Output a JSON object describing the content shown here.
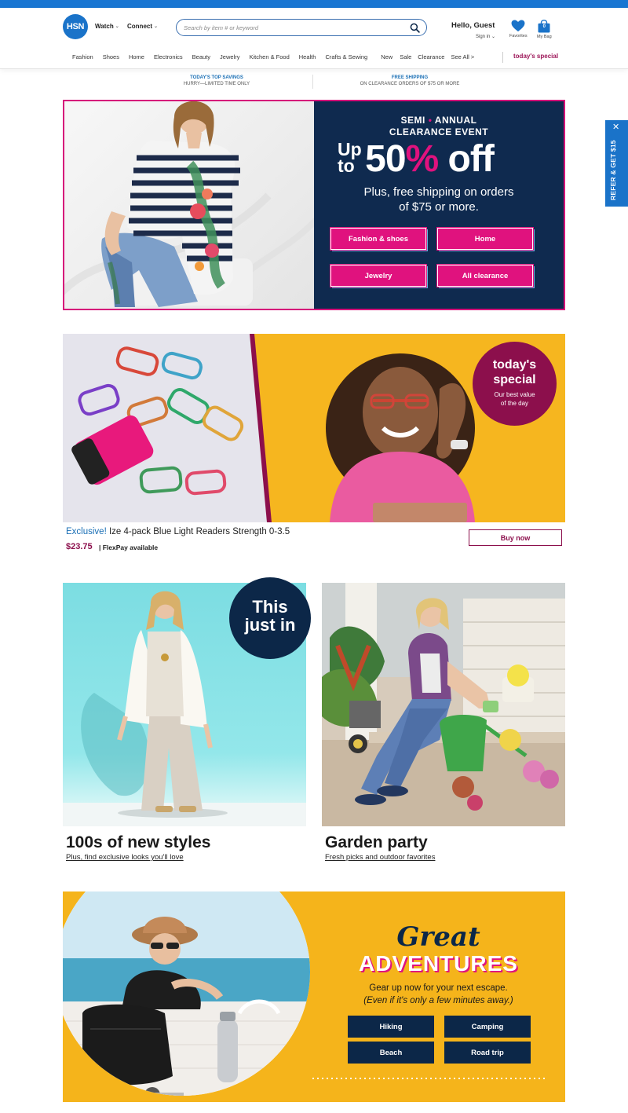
{
  "header": {
    "logo_text": "HSN",
    "watch_label": "Watch",
    "connect_label": "Connect",
    "search_placeholder": "Search by item # or keyword",
    "greeting": "Hello, Guest",
    "signin_label": "Sign in",
    "favorites_label": "Favorites",
    "bag_label": "My Bag",
    "bag_count": "0",
    "brand_color": "#1a73c9"
  },
  "categories": [
    "Fashion",
    "Shoes",
    "Home",
    "Electronics",
    "Beauty",
    "Jewelry",
    "Kitchen & Food",
    "Health",
    "Crafts & Sewing",
    "New",
    "Sale",
    "Clearance",
    "See All >"
  ],
  "todays_special_link": "today's special",
  "promo": {
    "savings_title": "TODAY'S TOP SAVINGS",
    "savings_sub": "HURRY—LIMITED TIME ONLY",
    "shipping_title": "FREE SHIPPING",
    "shipping_sub": "ON CLEARANCE ORDERS OF $75 OR MORE"
  },
  "hero": {
    "title_line1": "SEMI",
    "title_line1b": "ANNUAL",
    "title_line2": "CLEARANCE EVENT",
    "upto_1": "Up",
    "upto_2": "to",
    "percent": "50",
    "percent_sign": "%",
    "off": " off",
    "sub_line1": "Plus, free shipping on orders",
    "sub_line2": "of $75 or more.",
    "buttons": [
      "Fashion & shoes",
      "Home",
      "Jewelry",
      "All clearance"
    ],
    "accent_color": "#e0127e",
    "bg_color": "#0f2a4f"
  },
  "todays_special": {
    "badge_line1": "today's",
    "badge_line2": "special",
    "badge_sub1": "Our best value",
    "badge_sub2": "of the day",
    "exclusive": "Exclusive!",
    "product_name": "Ize 4-pack Blue Light Readers Strength 0-3.5",
    "price": "$23.75",
    "flexpay": "| FlexPay available",
    "buy_now": "Buy now"
  },
  "tiles": [
    {
      "badge": [
        "This",
        "just in"
      ],
      "title": "100s of new styles",
      "subtitle": "Plus, find exclusive looks you'll love"
    },
    {
      "title": "Garden party",
      "subtitle": "Fresh picks and outdoor favorites"
    }
  ],
  "adventures": {
    "title_script": "Great",
    "title_main": "ADVENTURES",
    "sub_line1": "Gear up now for your next escape.",
    "sub_line2": "(Even if it's only a few minutes away.)",
    "buttons": [
      "Hiking",
      "Camping",
      "Beach",
      "Road trip"
    ]
  },
  "refer": {
    "label": "REFER & GET $15",
    "close": "✕"
  }
}
